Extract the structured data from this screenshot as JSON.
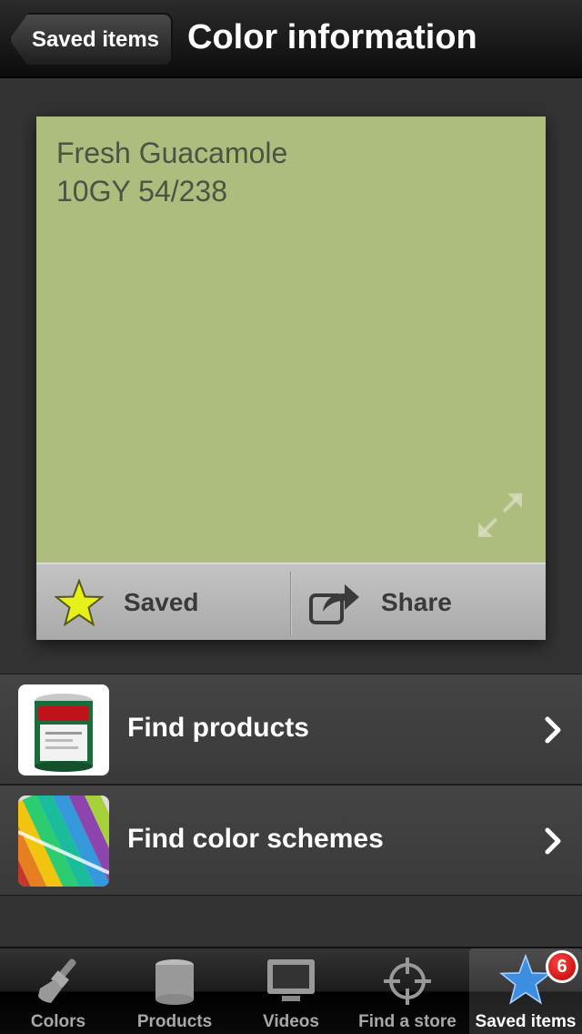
{
  "navbar": {
    "back_label": "Saved items",
    "title": "Color information"
  },
  "color": {
    "name": "Fresh Guacamole",
    "code": "10GY 54/238",
    "swatch_hex": "#adbd7e",
    "expand_icon": "expand-icon"
  },
  "actions": {
    "saved_label": "Saved",
    "saved_icon": "star-icon",
    "share_label": "Share",
    "share_icon": "share-icon"
  },
  "list": {
    "items": [
      {
        "label": "Find products",
        "icon": "paint-can-thumbnail"
      },
      {
        "label": "Find color schemes",
        "icon": "color-fan-thumbnail"
      }
    ]
  },
  "tabs": {
    "items": [
      {
        "label": "Colors",
        "icon": "brush-icon"
      },
      {
        "label": "Products",
        "icon": "paint-can-icon"
      },
      {
        "label": "Videos",
        "icon": "monitor-icon"
      },
      {
        "label": "Find a store",
        "icon": "crosshair-icon"
      },
      {
        "label": "Saved items",
        "icon": "star-icon",
        "active": true,
        "badge": "6"
      }
    ]
  },
  "colors": {
    "accent_star": "#e8f019",
    "badge_red": "#d11",
    "tab_active_star": "#3d8ee0"
  }
}
